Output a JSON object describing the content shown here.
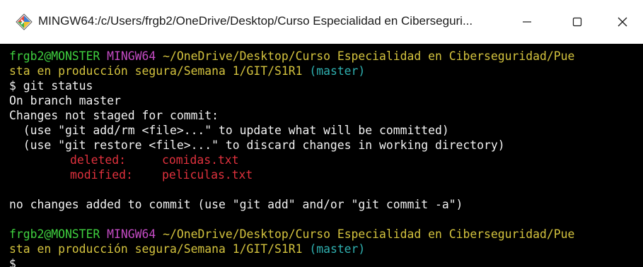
{
  "window": {
    "title": "MINGW64:/c/Users/frgb2/OneDrive/Desktop/Curso Especialidad en Ciberseguri...",
    "controls": {
      "minimize_icon": "minimize-icon",
      "maximize_icon": "maximize-icon",
      "close_icon": "close-icon"
    }
  },
  "colors": {
    "user_host": "#3fd13f",
    "mingw": "#c44bc4",
    "path": "#d4c33e",
    "branch": "#2fb0b0",
    "deleted_modified": "#e0313d",
    "text": "#f2f2f2",
    "background": "#000000"
  },
  "terminal": {
    "prompt1": {
      "user_host": "frgb2@MONSTER",
      "env": "MINGW64",
      "path_line1": "~/OneDrive/Desktop/Curso Especialidad en Ciberseguridad/Pue",
      "path_line2": "sta en producción segura/Semana 1/GIT/S1R1",
      "branch": "(master)"
    },
    "command": "$ git status",
    "output": [
      "On branch master",
      "Changes not staged for commit:",
      "  (use \"git add/rm <file>...\" to update what will be committed)",
      "  (use \"git restore <file>...\" to discard changes in working directory)"
    ],
    "changes": [
      {
        "status": "deleted:",
        "file": "comidas.txt"
      },
      {
        "status": "modified:",
        "file": "peliculas.txt"
      }
    ],
    "summary": "no changes added to commit (use \"git add\" and/or \"git commit -a\")",
    "prompt2": {
      "user_host": "frgb2@MONSTER",
      "env": "MINGW64",
      "path_line1": "~/OneDrive/Desktop/Curso Especialidad en Ciberseguridad/Pue",
      "path_line2": "sta en producción segura/Semana 1/GIT/S1R1",
      "branch": "(master)"
    },
    "prompt_symbol": "$"
  }
}
